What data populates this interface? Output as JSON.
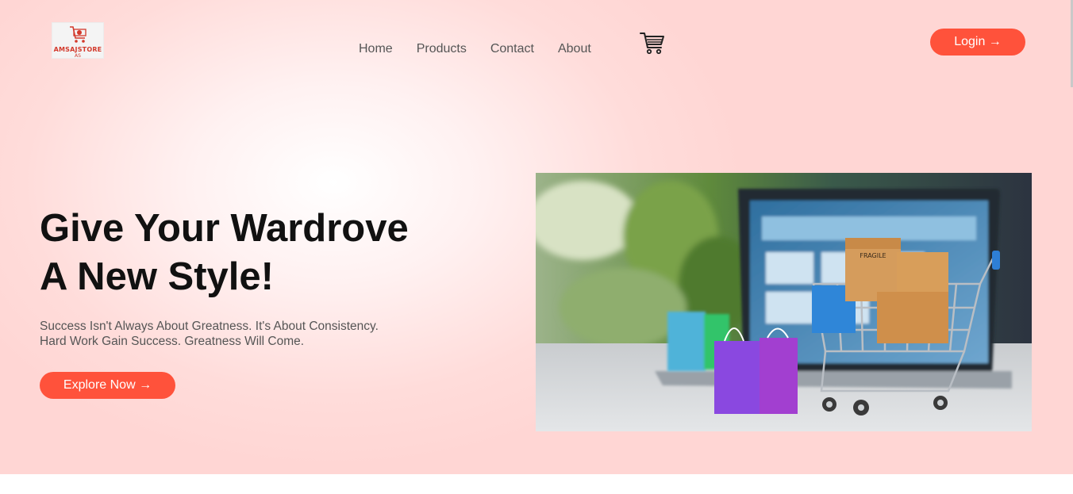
{
  "header": {
    "logo": {
      "brand": "AMSAJSTORE",
      "sub": "AS"
    },
    "nav": [
      {
        "label": "Home"
      },
      {
        "label": "Products"
      },
      {
        "label": "Contact"
      },
      {
        "label": "About"
      }
    ],
    "cart_icon": "shopping-cart-icon",
    "login_label": "Login →"
  },
  "hero": {
    "headline_line1": "Give Your Wardrove",
    "headline_line2": "A New Style!",
    "tagline_line1": "Success Isn't Always About Greatness. It's About Consistency.",
    "tagline_line2": "Hard Work Gain Success. Greatness Will Come.",
    "cta_label": "Explore Now →",
    "image_box_label": "FRAGILE"
  },
  "colors": {
    "accent": "#ff523b",
    "hero_bg": "#ffd6d4",
    "text_dark": "#111111",
    "text_muted": "#555555"
  }
}
